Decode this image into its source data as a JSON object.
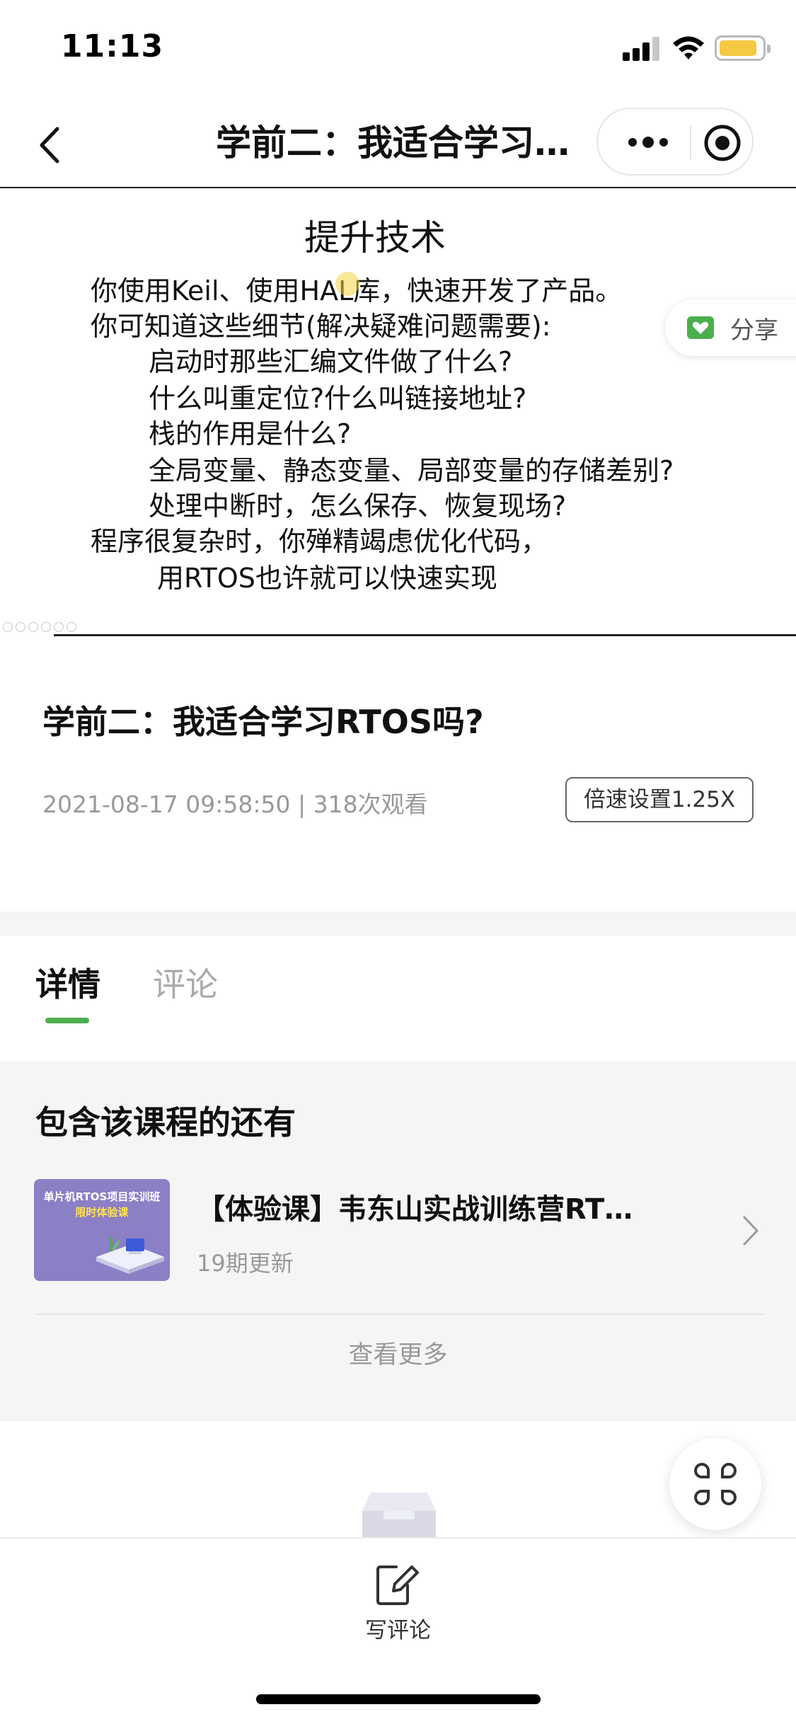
{
  "status_bar": {
    "time": "11:13",
    "battery_color": "#f5c943"
  },
  "nav": {
    "back_icon": "chevron-left-icon",
    "title": "学前二：我适合学习RTOS吗?",
    "more_icon": "more-dots-icon",
    "close_icon": "target-icon"
  },
  "slide": {
    "title": "提升技术",
    "lines": [
      "你使用Keil、使用HAL库，快速开发了产品。",
      "你可知道这些细节(解决疑难问题需要):",
      "启动时那些汇编文件做了什么?",
      "什么叫重定位?什么叫链接地址?",
      "栈的作用是什么?",
      "全局变量、静态变量、局部变量的存储差别?",
      "处理中断时，怎么保存、恢复现场?",
      "程序很复杂时，你殚精竭虑优化代码，",
      "用RTOS也许就可以快速实现"
    ],
    "share_label": "分享",
    "share_color": "#4cae4c"
  },
  "video": {
    "title": "学前二：我适合学习RTOS吗?",
    "meta": "2021-08-17 09:58:50 | 318次观看",
    "speed_label": "倍速设置1.25X"
  },
  "tabs": [
    {
      "label": "详情",
      "active": true
    },
    {
      "label": "评论",
      "active": false
    }
  ],
  "accent_color": "#4cae4c",
  "related": {
    "heading": "包含该课程的还有",
    "course": {
      "thumb_line1": "单片机RTOS项目实训班",
      "thumb_line2": "限时体验课",
      "title": "【体验课】韦东山实战训练营RTOS项目实训班",
      "subtitle": "19期更新"
    },
    "view_more": "查看更多"
  },
  "bottom_bar": {
    "write_label": "写评论"
  }
}
